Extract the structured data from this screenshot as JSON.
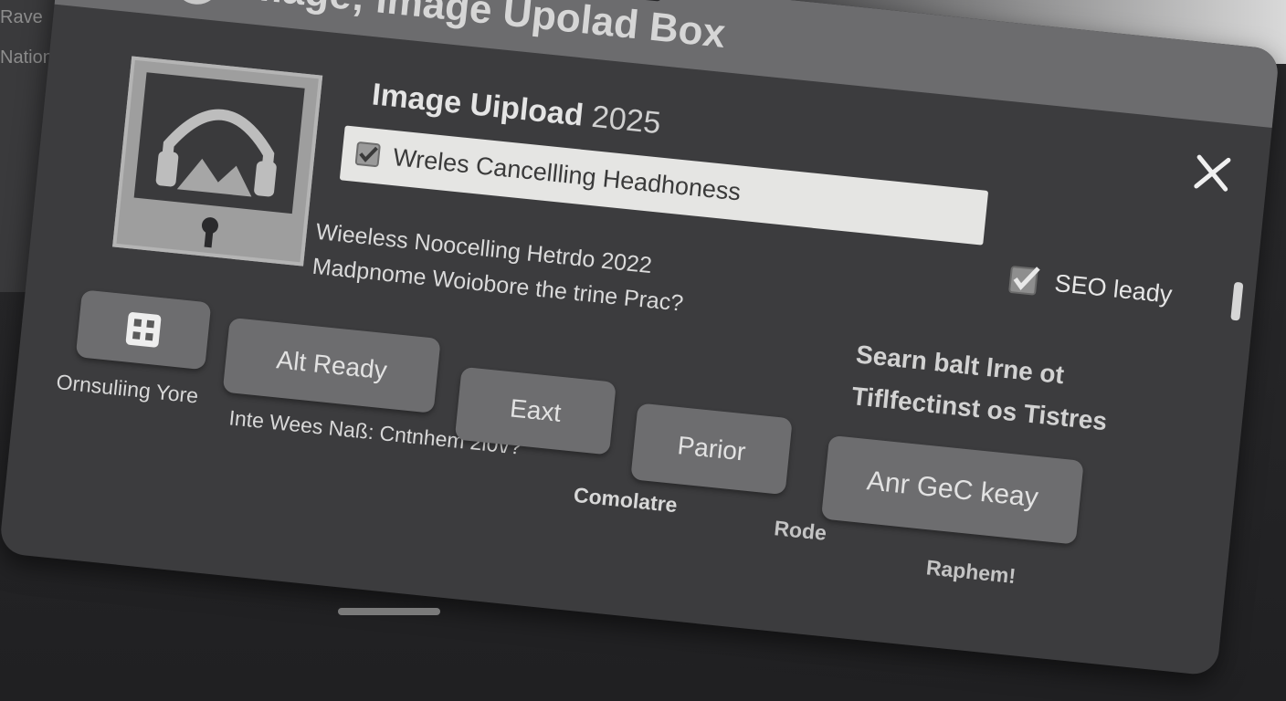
{
  "background": {
    "left_lines": [
      "Rave",
      "Nation"
    ]
  },
  "dialog": {
    "title": "Image; Image Upolad Box",
    "heading": "Image Uipload",
    "heading_year": "2025",
    "name_field": {
      "value": "Wreles Cancellling Headhoness",
      "checked": true
    },
    "seo": {
      "label": "SEO leady",
      "checked": true
    },
    "description": [
      "Wieeless Noocelling Hetrdo  2022",
      "Madpnome Woiobore the trine Prac?"
    ],
    "side_text": [
      "Searn balt lrne ot",
      "Tiflfectinst os Tistres"
    ],
    "grid_button_caption": "Ornsuliing Yore",
    "buttons": {
      "alt_ready": "Alt Ready",
      "eaxt": "Eaxt",
      "parior": "Parior",
      "anr_gec_keay": "Anr GeC keay"
    },
    "captions": {
      "inte_wees": "Inte  Wees Naß: Cntnhem 2l0\\/?",
      "comolatre": "Comolatre",
      "rode": "Rode",
      "raphem": "Raphem!"
    }
  },
  "colors": {
    "dialog_bg": "#3c3c3e",
    "titlebar_bg": "#6c6c6e",
    "input_bg": "#e5e5e3",
    "button_bg": "#6d6d6f",
    "text_light": "#e2e2e2"
  },
  "icons": {
    "app": "inbox-tray-icon",
    "title": "target-icon",
    "close": "close-icon",
    "preview": "headphones-image-icon",
    "grid": "dice-grid-icon",
    "check": "checkbox-checked-icon"
  }
}
